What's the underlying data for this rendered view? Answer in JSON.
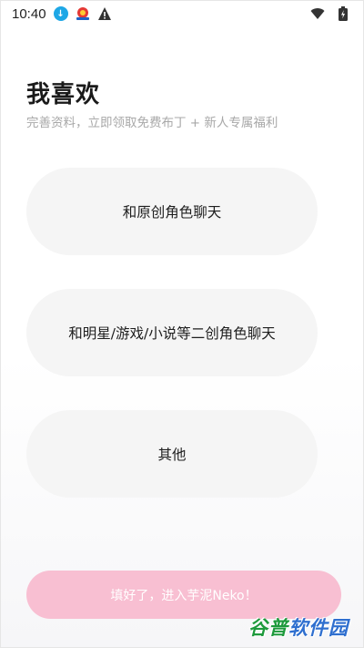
{
  "status_bar": {
    "time": "10:40",
    "icons": [
      "download-icon",
      "app-notification-icon",
      "warning-icon",
      "wifi-icon",
      "battery-icon"
    ]
  },
  "header": {
    "title": "我喜欢",
    "subtitle": "完善资料，立即领取免费布丁 + 新人专属福利"
  },
  "options": [
    {
      "label": "和原创角色聊天"
    },
    {
      "label": "和明星/游戏/小说等二创角色聊天"
    },
    {
      "label": "其他"
    }
  ],
  "submit": {
    "label": "填好了，进入芋泥Neko！"
  },
  "watermark": {
    "part_a": "谷普",
    "part_b": "软件园"
  },
  "colors": {
    "accent_pink": "#f8bfd2",
    "option_bg": "#f5f5f5",
    "title": "#1a1a1a",
    "subtitle": "#a8a8a8"
  }
}
